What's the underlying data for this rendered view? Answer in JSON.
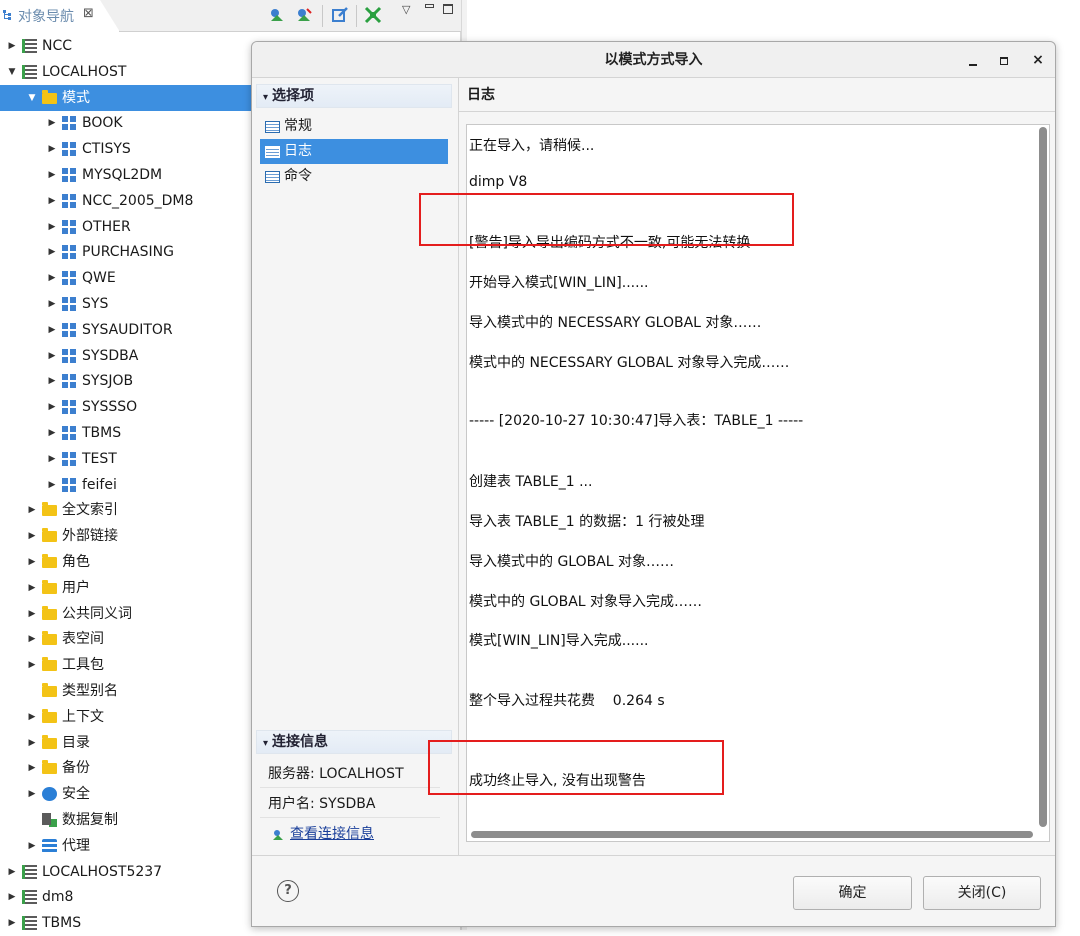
{
  "navigator": {
    "tab_label": "对象导航",
    "tab_close": "⊠",
    "tree": [
      {
        "label": "NCC",
        "level": 0,
        "arrow": "▶",
        "icon": "database-icon"
      },
      {
        "label": "LOCALHOST",
        "level": 0,
        "arrow": "▼",
        "icon": "database-icon"
      },
      {
        "label": "模式",
        "level": 1,
        "arrow": "▼",
        "icon": "folder-icon",
        "selected": true
      },
      {
        "label": "BOOK",
        "level": 2,
        "arrow": "▶",
        "icon": "schema-icon"
      },
      {
        "label": "CTISYS",
        "level": 2,
        "arrow": "▶",
        "icon": "schema-icon"
      },
      {
        "label": "MYSQL2DM",
        "level": 2,
        "arrow": "▶",
        "icon": "schema-icon"
      },
      {
        "label": "NCC_2005_DM8",
        "level": 2,
        "arrow": "▶",
        "icon": "schema-icon"
      },
      {
        "label": "OTHER",
        "level": 2,
        "arrow": "▶",
        "icon": "schema-icon"
      },
      {
        "label": "PURCHASING",
        "level": 2,
        "arrow": "▶",
        "icon": "schema-icon"
      },
      {
        "label": "QWE",
        "level": 2,
        "arrow": "▶",
        "icon": "schema-icon"
      },
      {
        "label": "SYS",
        "level": 2,
        "arrow": "▶",
        "icon": "schema-icon"
      },
      {
        "label": "SYSAUDITOR",
        "level": 2,
        "arrow": "▶",
        "icon": "schema-icon"
      },
      {
        "label": "SYSDBA",
        "level": 2,
        "arrow": "▶",
        "icon": "schema-icon"
      },
      {
        "label": "SYSJOB",
        "level": 2,
        "arrow": "▶",
        "icon": "schema-icon"
      },
      {
        "label": "SYSSSO",
        "level": 2,
        "arrow": "▶",
        "icon": "schema-icon"
      },
      {
        "label": "TBMS",
        "level": 2,
        "arrow": "▶",
        "icon": "schema-icon"
      },
      {
        "label": "TEST",
        "level": 2,
        "arrow": "▶",
        "icon": "schema-icon"
      },
      {
        "label": "feifei",
        "level": 2,
        "arrow": "▶",
        "icon": "schema-icon"
      },
      {
        "label": "全文索引",
        "level": 1,
        "arrow": "▶",
        "icon": "folder-icon"
      },
      {
        "label": "外部链接",
        "level": 1,
        "arrow": "▶",
        "icon": "folder-icon"
      },
      {
        "label": "角色",
        "level": 1,
        "arrow": "▶",
        "icon": "folder-icon"
      },
      {
        "label": "用户",
        "level": 1,
        "arrow": "▶",
        "icon": "folder-icon"
      },
      {
        "label": "公共同义词",
        "level": 1,
        "arrow": "▶",
        "icon": "folder-icon"
      },
      {
        "label": "表空间",
        "level": 1,
        "arrow": "▶",
        "icon": "folder-icon"
      },
      {
        "label": "工具包",
        "level": 1,
        "arrow": "▶",
        "icon": "folder-icon"
      },
      {
        "label": "类型别名",
        "level": 1,
        "arrow": "",
        "icon": "folder-icon"
      },
      {
        "label": "上下文",
        "level": 1,
        "arrow": "▶",
        "icon": "folder-icon"
      },
      {
        "label": "目录",
        "level": 1,
        "arrow": "▶",
        "icon": "folder-icon"
      },
      {
        "label": "备份",
        "level": 1,
        "arrow": "▶",
        "icon": "folder-icon"
      },
      {
        "label": "安全",
        "level": 1,
        "arrow": "▶",
        "icon": "shield-icon"
      },
      {
        "label": "数据复制",
        "level": 1,
        "arrow": "",
        "icon": "replication-icon"
      },
      {
        "label": "代理",
        "level": 1,
        "arrow": "▶",
        "icon": "stack-icon"
      },
      {
        "label": "LOCALHOST5237",
        "level": 0,
        "arrow": "▶",
        "icon": "database-icon"
      },
      {
        "label": "dm8",
        "level": 0,
        "arrow": "▶",
        "icon": "database-icon"
      },
      {
        "label": "TBMS",
        "level": 0,
        "arrow": "▶",
        "icon": "database-icon"
      }
    ]
  },
  "dialog": {
    "title": "以模式方式导入",
    "close_glyph": "×",
    "sections": {
      "options_header": "选择项",
      "items": [
        {
          "label": "常规",
          "active": false
        },
        {
          "label": "日志",
          "active": true
        },
        {
          "label": "命令",
          "active": false
        }
      ],
      "connection_header": "连接信息",
      "server_label": "服务器: LOCALHOST",
      "user_label": "用户名: SYSDBA",
      "view_link": "查看连接信息",
      "arrow": "▾"
    },
    "log": {
      "header": "日志",
      "lines": [
        "正在导入，请稍候...",
        "dimp V8",
        "[警告]导入导出编码方式不一致,可能无法转换",
        "开始导入模式[WIN_LIN]......",
        "导入模式中的 NECESSARY GLOBAL 对象……",
        "模式中的 NECESSARY GLOBAL 对象导入完成……",
        "----- [2020-10-27 10:30:47]导入表：TABLE_1 -----",
        "创建表 TABLE_1 ...",
        "导入表 TABLE_1 的数据：1 行被处理",
        "导入模式中的 GLOBAL 对象……",
        "模式中的 GLOBAL 对象导入完成……",
        "模式[WIN_LIN]导入完成......",
        "整个导入过程共花费    0.264 s",
        "成功终止导入, 没有出现警告"
      ]
    },
    "buttons": {
      "help": "?",
      "ok": "确定",
      "close": "关闭(C)"
    }
  },
  "colors": {
    "selection": "#3d8fe0",
    "highlight_red": "#e41d1d",
    "folder": "#f3c316",
    "schema": "#3c7fcf"
  }
}
